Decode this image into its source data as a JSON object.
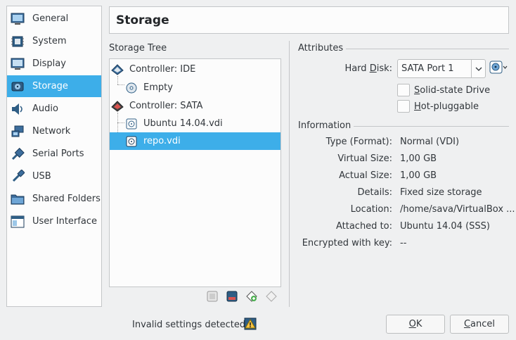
{
  "sidebar": {
    "items": [
      {
        "label": "General",
        "icon": "general-icon"
      },
      {
        "label": "System",
        "icon": "system-icon"
      },
      {
        "label": "Display",
        "icon": "display-icon"
      },
      {
        "label": "Storage",
        "icon": "storage-icon",
        "selected": true
      },
      {
        "label": "Audio",
        "icon": "audio-icon"
      },
      {
        "label": "Network",
        "icon": "network-icon"
      },
      {
        "label": "Serial Ports",
        "icon": "serial-ports-icon"
      },
      {
        "label": "USB",
        "icon": "usb-icon"
      },
      {
        "label": "Shared Folders",
        "icon": "shared-folders-icon"
      },
      {
        "label": "User Interface",
        "icon": "user-interface-icon"
      }
    ]
  },
  "header": {
    "title": "Storage"
  },
  "tree": {
    "label": "Storage Tree",
    "rows": [
      {
        "label": "Controller: IDE",
        "icon": "ide-controller-icon"
      },
      {
        "label": "Empty",
        "icon": "optical-disc-icon"
      },
      {
        "label": "Controller: SATA",
        "icon": "sata-controller-icon"
      },
      {
        "label": "Ubuntu 14.04.vdi",
        "icon": "hard-disk-icon"
      },
      {
        "label": "repo.vdi",
        "icon": "hard-disk-icon",
        "selected": true
      }
    ],
    "toolbar": [
      "add-controller-icon",
      "remove-controller-icon",
      "add-attachment-icon",
      "remove-attachment-icon"
    ]
  },
  "attributes": {
    "title": "Attributes",
    "hard_disk_label_pre": "Hard ",
    "hard_disk_label_u": "D",
    "hard_disk_label_post": "isk:",
    "hard_disk_value": "SATA Port 1",
    "solid_state_u": "S",
    "solid_state_rest": "olid-state Drive",
    "hot_pluggable_u": "H",
    "hot_pluggable_rest": "ot-pluggable"
  },
  "information": {
    "title": "Information",
    "rows": [
      {
        "label": "Type (Format):",
        "value": "Normal (VDI)"
      },
      {
        "label": "Virtual Size:",
        "value": "1,00 GB"
      },
      {
        "label": "Actual Size:",
        "value": "1,00 GB"
      },
      {
        "label": "Details:",
        "value": "Fixed size storage"
      },
      {
        "label": "Location:",
        "value": "/home/sava/VirtualBox ..."
      },
      {
        "label": "Attached to:",
        "value": "Ubuntu 14.04 (SSS)"
      },
      {
        "label": "Encrypted with key:",
        "value": "--"
      }
    ]
  },
  "footer": {
    "status": "Invalid settings detected",
    "ok_u": "O",
    "ok_rest": "K",
    "cancel_u": "C",
    "cancel_rest": "ancel"
  },
  "colors": {
    "selection": "#3daee9",
    "background": "#eff0f1"
  }
}
